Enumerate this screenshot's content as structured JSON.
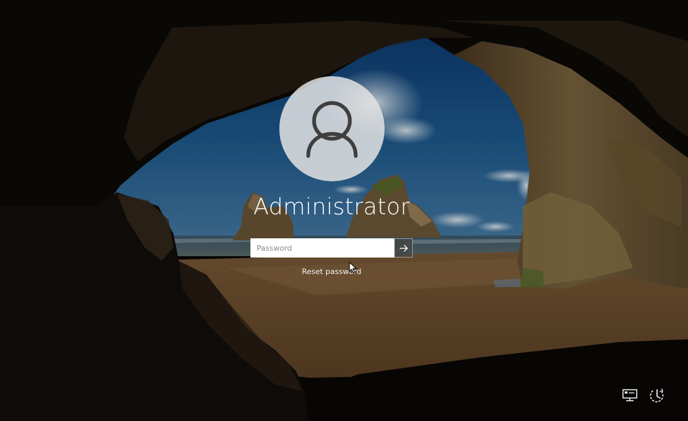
{
  "login": {
    "username": "Administrator",
    "password_placeholder": "Password",
    "password_value": "",
    "reset_link": "Reset password"
  },
  "icons": {
    "avatar": "user-silhouette-icon",
    "submit": "arrow-right-icon",
    "network": "network-icon",
    "ease_of_access": "ease-of-access-icon"
  },
  "colors": {
    "text": "#ffffff",
    "input_background": "#ffffff",
    "placeholder": "#8a8a8a",
    "avatar_circle": "#e2e2e2"
  }
}
